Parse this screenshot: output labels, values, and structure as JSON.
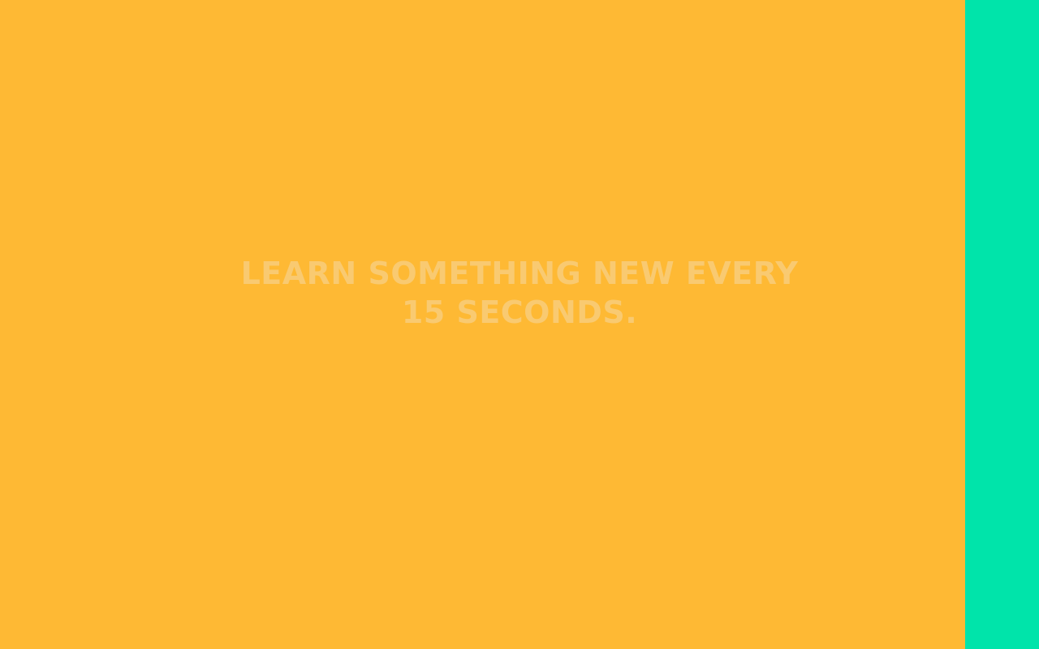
{
  "hero": {
    "headline_line1": "LEARN SOMETHING NEW EVERY",
    "headline_line2": "15 SECONDS."
  },
  "colors": {
    "background": "#FEB934",
    "side_panel": "#00E4AA",
    "headline_text": "#F9CA71"
  }
}
